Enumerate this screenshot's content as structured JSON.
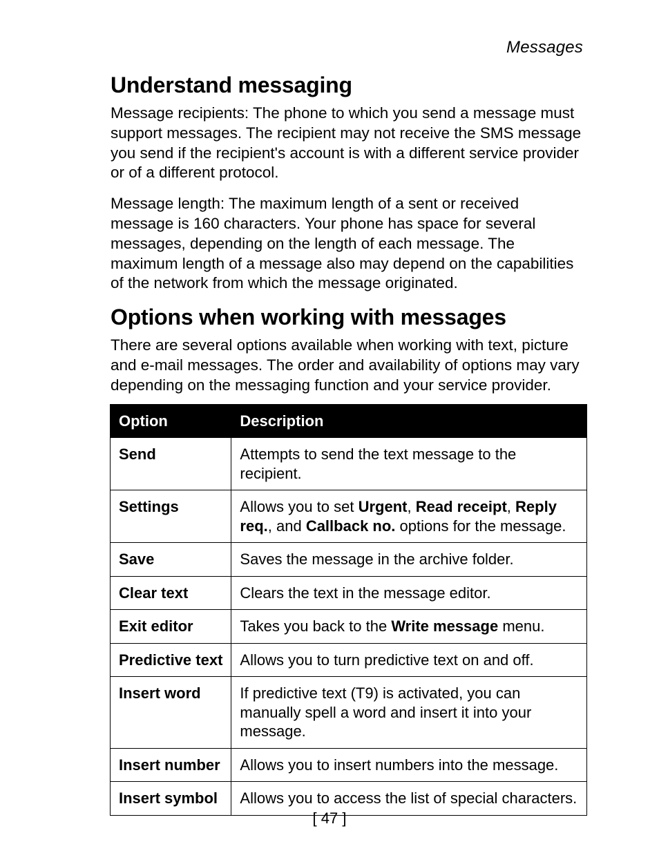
{
  "running_head": "Messages",
  "section1": {
    "title": "Understand messaging",
    "para1": "Message recipients: The phone to which you send a message must support  messages. The recipient may not receive the SMS message you send if the recipient's account is with a different service provider or of a different protocol.",
    "para2": "Message length: The maximum length of a sent or received message is 160 characters. Your phone has space for several messages, depending on the length of each message. The maximum length of a message also may depend on the capabilities of the network from which the message originated."
  },
  "section2": {
    "title": "Options when working with messages",
    "para1": "There are several options available when working with text, picture and e-mail messages. The order and availability of options may vary depending on the messaging function and your service provider."
  },
  "table": {
    "headers": {
      "col1": "Option",
      "col2": "Description"
    },
    "rows": [
      {
        "option": "Send",
        "desc_segments": [
          {
            "text": "Attempts to send the text message to the recipient.",
            "bold": false
          }
        ]
      },
      {
        "option": "Settings",
        "desc_segments": [
          {
            "text": "Allows you to set ",
            "bold": false
          },
          {
            "text": "Urgent",
            "bold": true
          },
          {
            "text": ", ",
            "bold": false
          },
          {
            "text": "Read receipt",
            "bold": true
          },
          {
            "text": ", ",
            "bold": false
          },
          {
            "text": "Reply req.",
            "bold": true
          },
          {
            "text": ", and ",
            "bold": false
          },
          {
            "text": "Callback no.",
            "bold": true
          },
          {
            "text": " options for the message.",
            "bold": false
          }
        ]
      },
      {
        "option": "Save",
        "desc_segments": [
          {
            "text": "Saves the message in the archive folder.",
            "bold": false
          }
        ]
      },
      {
        "option": "Clear text",
        "desc_segments": [
          {
            "text": "Clears the text in the message editor.",
            "bold": false
          }
        ]
      },
      {
        "option": "Exit editor",
        "desc_segments": [
          {
            "text": "Takes you back to the ",
            "bold": false
          },
          {
            "text": "Write message",
            "bold": true
          },
          {
            "text": " menu.",
            "bold": false
          }
        ]
      },
      {
        "option": "Predictive text",
        "desc_segments": [
          {
            "text": "Allows you to turn predictive text on and off.",
            "bold": false
          }
        ]
      },
      {
        "option": "Insert word",
        "desc_segments": [
          {
            "text": "If predictive text (T9) is activated, you can manually spell a word and insert it into your message.",
            "bold": false
          }
        ]
      },
      {
        "option": "Insert number",
        "desc_segments": [
          {
            "text": "Allows you to insert numbers into the message.",
            "bold": false
          }
        ]
      },
      {
        "option": "Insert symbol",
        "desc_segments": [
          {
            "text": "Allows you to access the list of special characters.",
            "bold": false
          }
        ]
      }
    ]
  },
  "page_number": "[ 47 ]"
}
